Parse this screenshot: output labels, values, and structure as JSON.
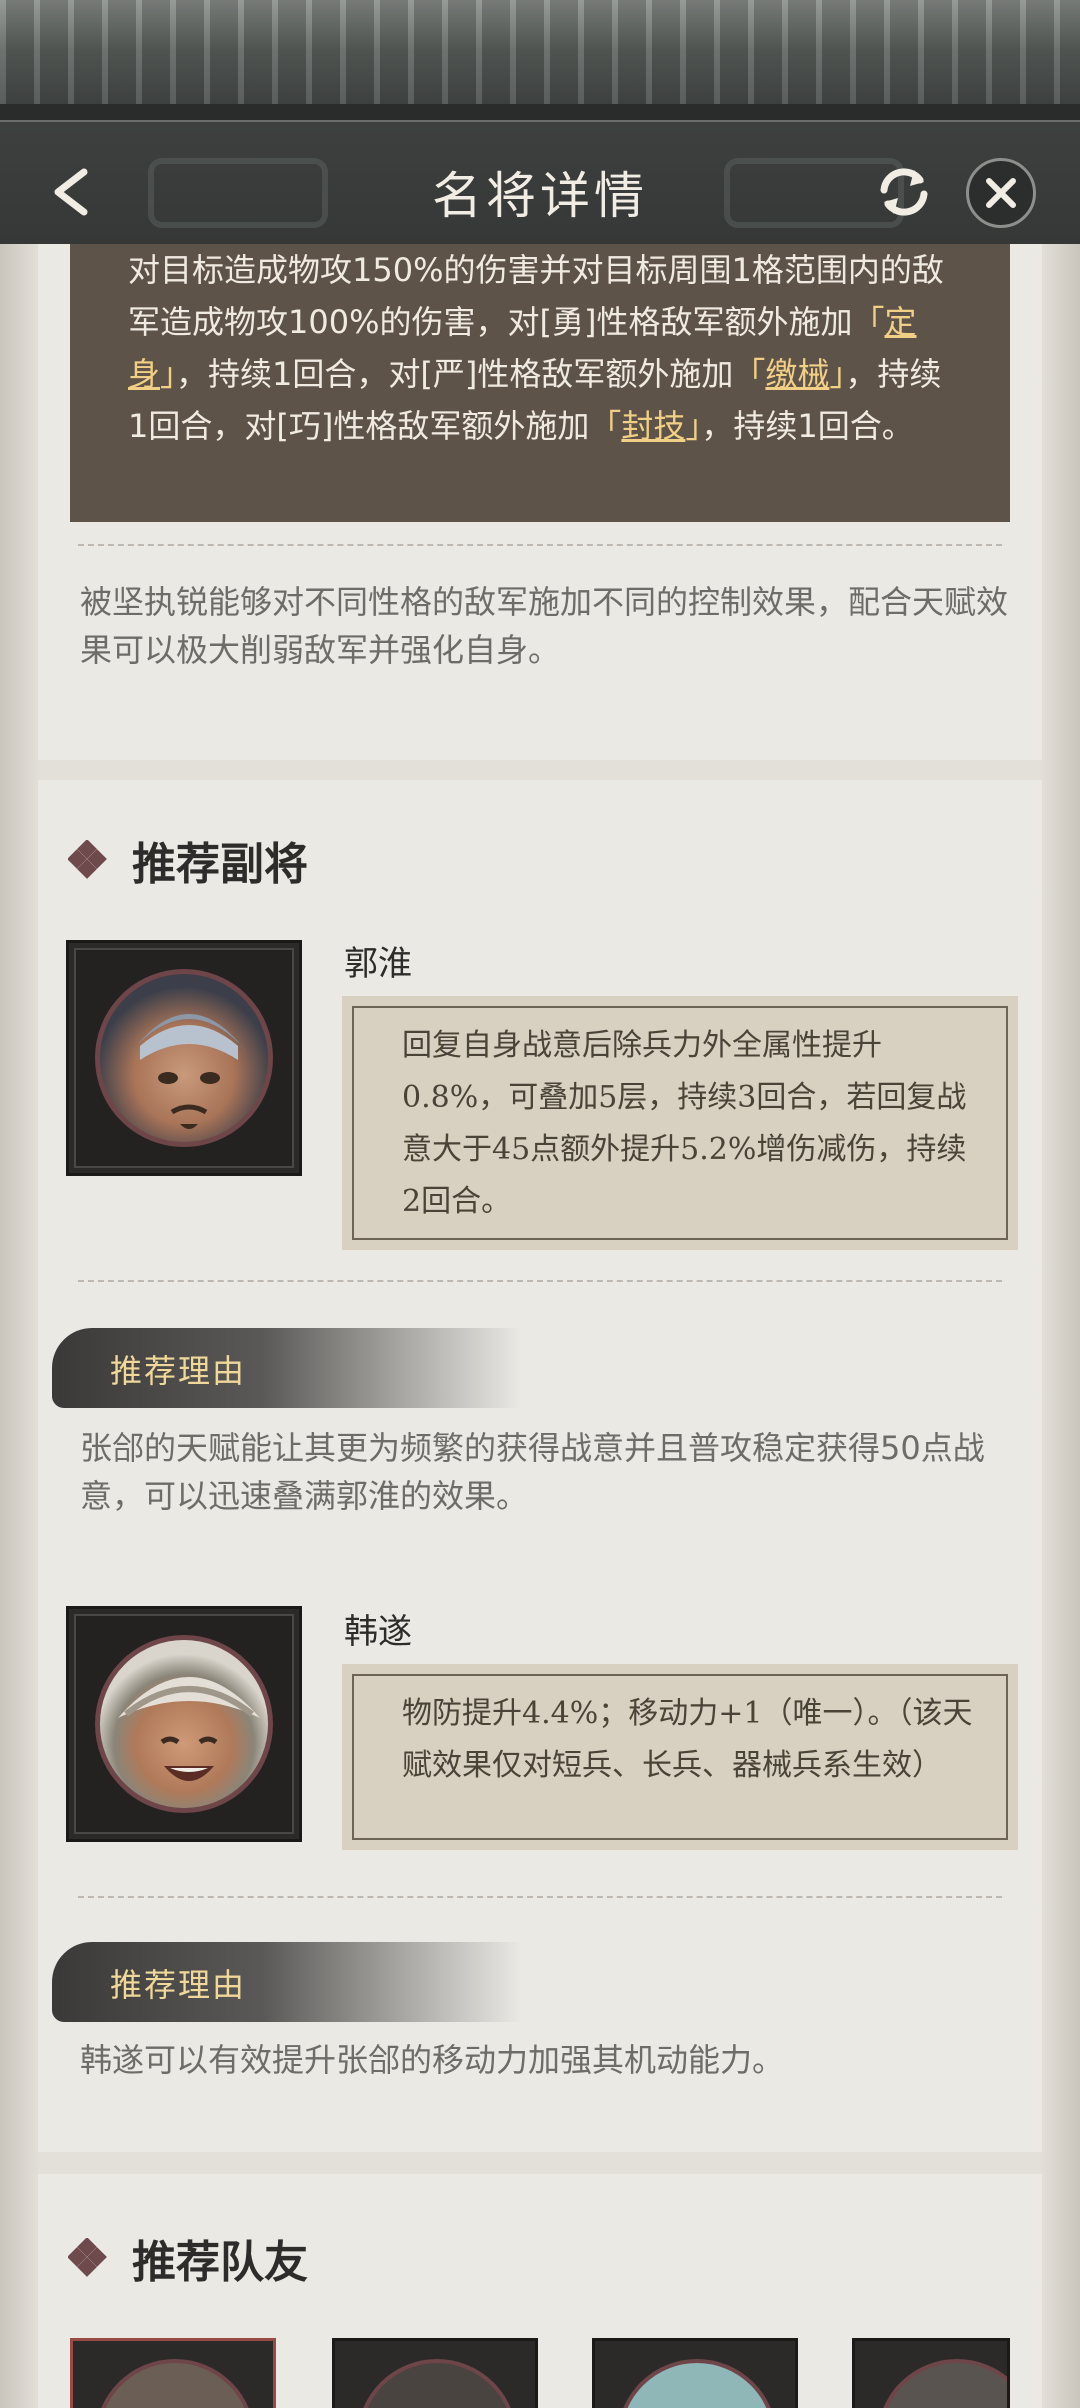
{
  "header": {
    "title": "名将详情",
    "back_icon": "chevron-left-icon",
    "refresh_icon": "refresh-icon",
    "close_icon": "close-icon"
  },
  "skill": {
    "parts": [
      {
        "text": "对目标造成物攻150%的伤害并对目标周围1格范围内的敌军造成物攻100%的伤害，对[勇]性格敌军额外施加",
        "style": "plain"
      },
      {
        "text": "「定身」",
        "style": "highlight"
      },
      {
        "text": "，持续1回合，对[严]性格敌军额外施加",
        "style": "plain"
      },
      {
        "text": "「缴械」",
        "style": "highlight"
      },
      {
        "text": "，持续1回合，对[巧]性格敌军额外施加",
        "style": "plain"
      },
      {
        "text": "「封技」",
        "style": "highlight"
      },
      {
        "text": "，持续1回合。",
        "style": "plain"
      }
    ],
    "description": "被坚执锐能够对不同性格的敌军施加不同的控制效果，配合天赋效果可以极大削弱敌军并强化自身。"
  },
  "recommended_deputy": {
    "title": "推荐副将",
    "heroes": [
      {
        "name": "郭淮",
        "talent": "回复自身战意后除兵力外全属性提升0.8%，可叠加5层，持续3回合，若回复战意大于45点额外提升5.2%增伤减伤，持续2回合。",
        "reason_label": "推荐理由",
        "reason": "张郃的天赋能让其更为频繁的获得战意并且普攻稳定获得50点战意，可以迅速叠满郭淮的效果。"
      },
      {
        "name": "韩遂",
        "talent": "物防提升4.4%；移动力+1（唯一）。（该天赋效果仅对短兵、长兵、器械兵系生效）",
        "reason_label": "推荐理由",
        "reason": "韩遂可以有效提升张郃的移动力加强其机动能力。"
      }
    ]
  },
  "recommended_team": {
    "title": "推荐队友"
  },
  "colors": {
    "highlight": "#f1cf86",
    "skill_bg": "#5e5348",
    "reason_text": "#f0d79a"
  }
}
